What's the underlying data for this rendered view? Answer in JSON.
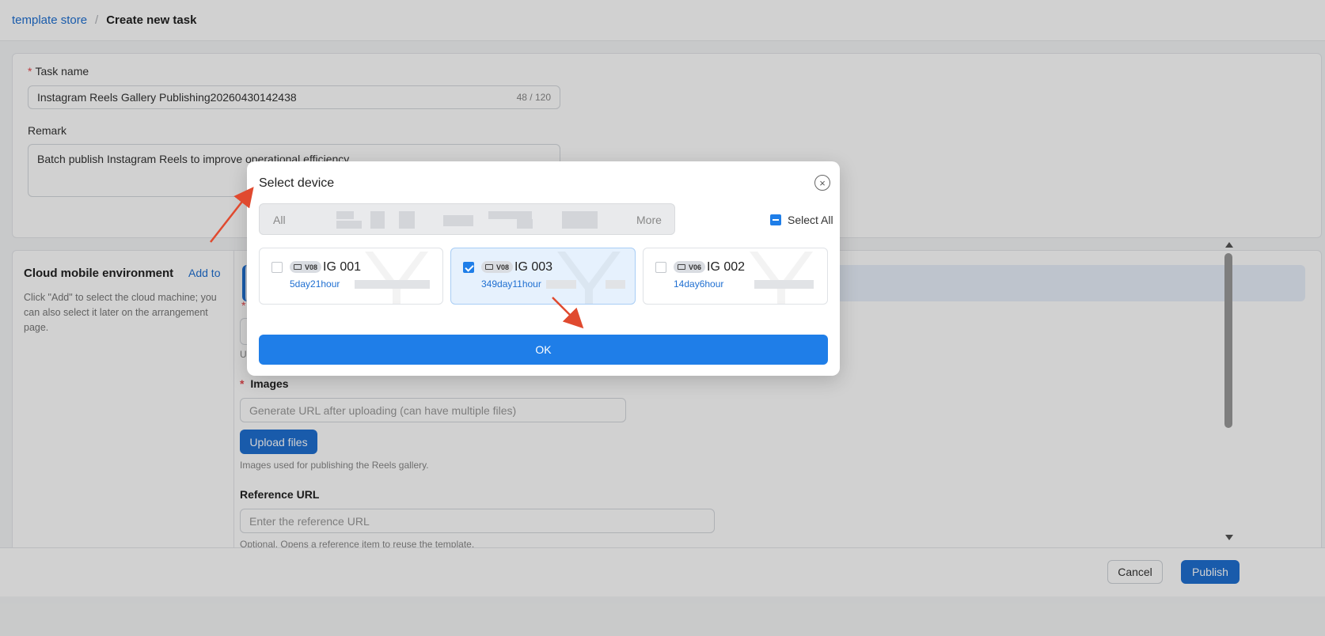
{
  "breadcrumb": {
    "parent": "template store",
    "separator": "/",
    "current": "Create new task"
  },
  "task": {
    "name_label": "Task name",
    "required_mark": "*",
    "name_value": "Instagram Reels Gallery Publishing20260430142438",
    "name_counter": "48 / 120",
    "remark_label": "Remark",
    "remark_value": "Batch publish Instagram Reels to improve operational efficiency."
  },
  "env": {
    "title": "Cloud mobile environment",
    "add_link": "Add to",
    "description": "Click \"Add\" to select the cloud machine; you can also select it later on the arrangement page."
  },
  "form": {
    "u_prefix": "U",
    "images_label": "Images",
    "images_placeholder": "Generate URL after uploading (can have multiple files)",
    "upload_button": "Upload files",
    "images_help": "Images used for publishing the Reels gallery.",
    "ref_label": "Reference URL",
    "ref_placeholder": "Enter the reference URL",
    "ref_help": "Optional. Opens a reference item to reuse the template."
  },
  "footer": {
    "cancel": "Cancel",
    "publish": "Publish"
  },
  "modal": {
    "title": "Select device",
    "close_icon": "close-circle-icon",
    "filter_all": "All",
    "filter_more": "More",
    "select_all": "Select All",
    "ok": "OK",
    "devices": [
      {
        "name": "IG 001",
        "version": "V08",
        "time": "5day21hour",
        "checked": false
      },
      {
        "name": "IG 003",
        "version": "V08",
        "time": "349day11hour",
        "checked": true
      },
      {
        "name": "IG 002",
        "version": "V06",
        "time": "14day6hour",
        "checked": false
      }
    ]
  },
  "colors": {
    "accent": "#1f7ee8",
    "link": "#1f6fd1",
    "annotation_arrow": "#e04a2f",
    "required": "#e5484d"
  }
}
